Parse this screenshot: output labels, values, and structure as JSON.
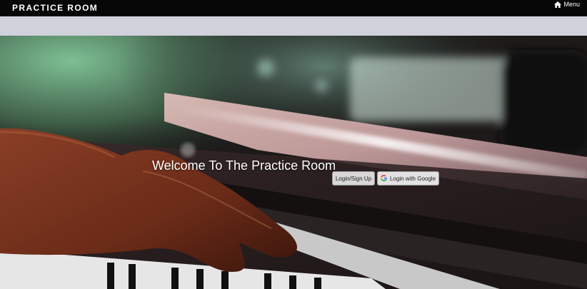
{
  "navbar": {
    "brand": "PRACTICE ROOM",
    "menu_label": "Menu",
    "menu_icon": "home-icon"
  },
  "hero": {
    "image": "hands-playing-piano-photo",
    "welcome_text": "Welcome To The Practice Room",
    "login_button": "Login/Sign Up",
    "google_button": "Login with Google",
    "google_icon": "google-g-icon"
  },
  "colors": {
    "navbar_bg": "#070707",
    "subbar_bg": "#d1d1db",
    "button_bg": "#d8d6d6",
    "text_light": "#ffffff"
  }
}
